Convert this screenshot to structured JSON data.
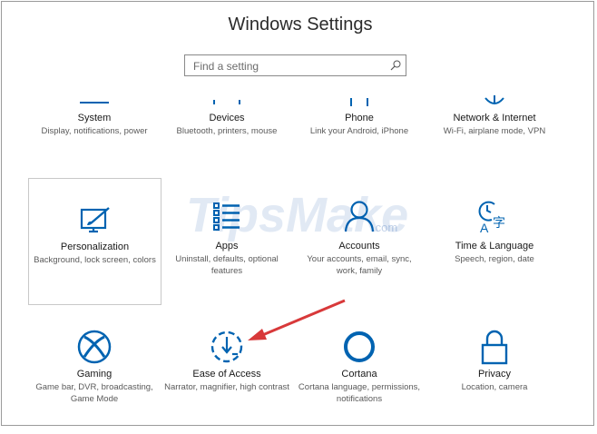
{
  "window": {
    "title": "Windows Settings"
  },
  "search": {
    "placeholder": "Find a setting"
  },
  "tiles": [
    {
      "label": "System",
      "desc": "Display, notifications, power",
      "icon": "laptop-icon"
    },
    {
      "label": "Devices",
      "desc": "Bluetooth, printers, mouse",
      "icon": "keyboard-icon"
    },
    {
      "label": "Phone",
      "desc": "Link your Android, iPhone",
      "icon": "phone-icon"
    },
    {
      "label": "Network & Internet",
      "desc": "Wi-Fi, airplane mode, VPN",
      "icon": "globe-icon"
    },
    {
      "label": "Personalization",
      "desc": "Background, lock screen, colors",
      "icon": "paintbrush-icon"
    },
    {
      "label": "Apps",
      "desc": "Uninstall, defaults, optional features",
      "icon": "apps-list-icon"
    },
    {
      "label": "Accounts",
      "desc": "Your accounts, email, sync, work, family",
      "icon": "person-icon"
    },
    {
      "label": "Time & Language",
      "desc": "Speech, region, date",
      "icon": "time-language-icon"
    },
    {
      "label": "Gaming",
      "desc": "Game bar, DVR, broadcasting, Game Mode",
      "icon": "xbox-icon"
    },
    {
      "label": "Ease of Access",
      "desc": "Narrator, magnifier, high contrast",
      "icon": "ease-of-access-icon"
    },
    {
      "label": "Cortana",
      "desc": "Cortana language, permissions, notifications",
      "icon": "cortana-icon"
    },
    {
      "label": "Privacy",
      "desc": "Location, camera",
      "icon": "lock-icon"
    }
  ],
  "watermark": {
    "text": "TipsMake",
    "suffix": ".com"
  },
  "colors": {
    "accent": "#0063b1",
    "annotation_arrow": "#d8393a"
  }
}
